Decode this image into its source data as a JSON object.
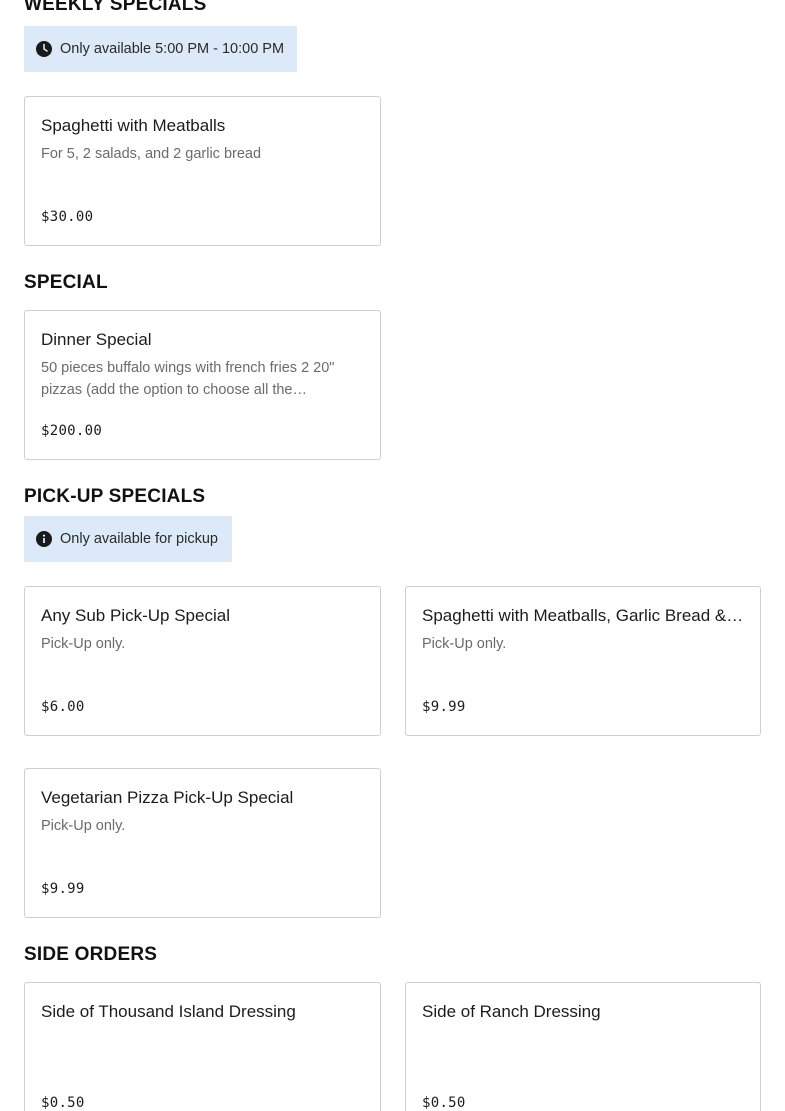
{
  "sections": {
    "weekly": {
      "title": "WEEKLY SPECIALS",
      "notice": "Only available 5:00 PM - 10:00 PM",
      "items": [
        {
          "name": "Spaghetti with Meatballs",
          "desc": "For 5, 2 salads, and 2 garlic bread",
          "price": "$30.00"
        }
      ]
    },
    "special": {
      "title": "SPECIAL",
      "items": [
        {
          "name": "Dinner Special",
          "desc": "50 pieces buffalo wings with french fries 2 20\" pizzas (add the option to choose all the pizzas…",
          "price": "$200.00"
        }
      ]
    },
    "pickup": {
      "title": "PICK-UP SPECIALS",
      "notice": "Only available for pickup",
      "items": [
        {
          "name": "Any Sub Pick-Up Special",
          "desc": "Pick-Up only.",
          "price": "$6.00"
        },
        {
          "name": "Spaghetti with Meatballs, Garlic Bread &…",
          "desc": "Pick-Up only.",
          "price": "$9.99"
        },
        {
          "name": "Vegetarian Pizza Pick-Up Special",
          "desc": "Pick-Up only.",
          "price": "$9.99"
        }
      ]
    },
    "sides": {
      "title": "SIDE ORDERS",
      "items": [
        {
          "name": "Side of Thousand Island Dressing",
          "desc": "",
          "price": "$0.50"
        },
        {
          "name": "Side of Ranch Dressing",
          "desc": "",
          "price": "$0.50"
        }
      ]
    }
  },
  "icons": {
    "clock": "clock-icon",
    "info": "info-icon"
  },
  "colors": {
    "notice_bg": "#dce9f8",
    "card_border": "#cfcfcf"
  }
}
